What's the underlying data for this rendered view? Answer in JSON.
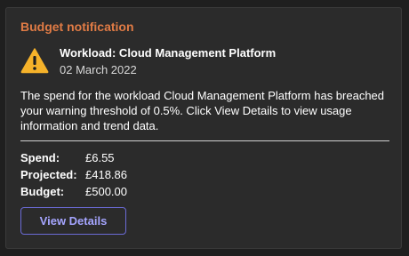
{
  "card": {
    "title": "Budget notification",
    "accent_color": "#e07b45"
  },
  "header": {
    "icon": "warning-triangle-icon",
    "workload_title": "Workload: Cloud Management Platform",
    "date": "02 March 2022"
  },
  "message": "The spend for the workload Cloud Management Platform has breached your warning threshold of 0.5%. Click View Details to view usage information and trend data.",
  "stats": [
    {
      "label": "Spend:",
      "value": "£6.55"
    },
    {
      "label": "Projected:",
      "value": "£418.86"
    },
    {
      "label": "Budget:",
      "value": "£500.00"
    }
  ],
  "actions": {
    "view_details_label": "View Details",
    "button_color": "#6b6bd6"
  }
}
